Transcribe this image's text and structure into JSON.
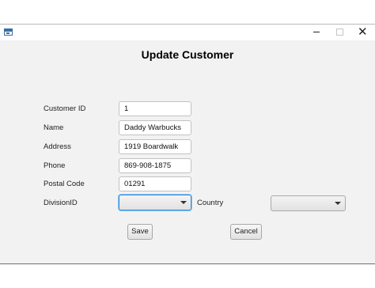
{
  "window": {
    "controls": {
      "minimize_icon": "minimize-icon",
      "maximize_icon": "maximize-icon",
      "close_icon": "close-icon"
    }
  },
  "form": {
    "title": "Update Customer",
    "fields": {
      "customer_id": {
        "label": "Customer ID",
        "value": "1"
      },
      "name": {
        "label": "Name",
        "value": "Daddy Warbucks"
      },
      "address": {
        "label": "Address",
        "value": "1919 Boardwalk"
      },
      "phone": {
        "label": "Phone",
        "value": "869-908-1875"
      },
      "postal_code": {
        "label": "Postal Code",
        "value": "01291"
      }
    },
    "division": {
      "label": "DivisionID",
      "selected": ""
    },
    "country": {
      "label": "Country",
      "selected": ""
    },
    "buttons": {
      "save": "Save",
      "cancel": "Cancel"
    }
  },
  "colors": {
    "focus_ring": "#2f8ce1",
    "background": "#f2f2f2"
  }
}
